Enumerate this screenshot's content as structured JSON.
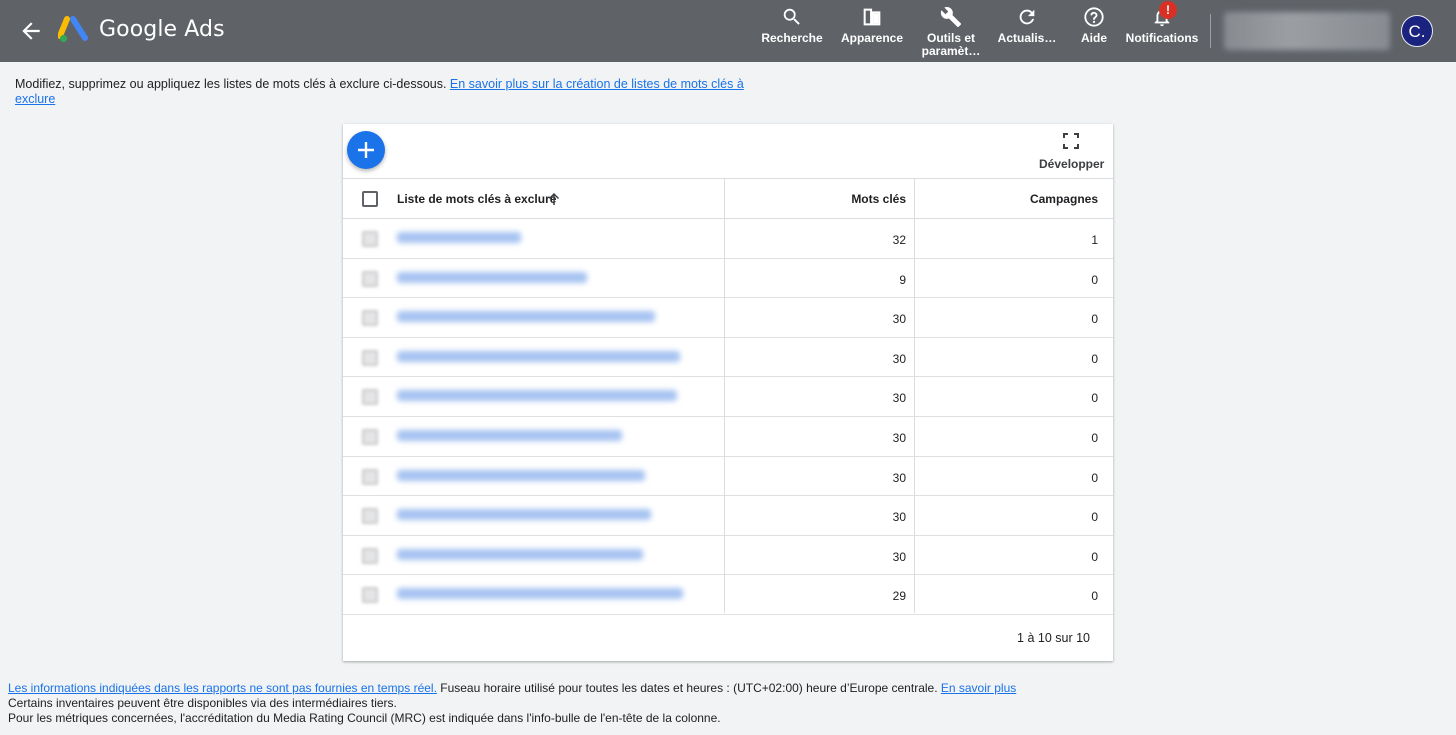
{
  "app": {
    "brand": "Google Ads",
    "avatar_letter": "C."
  },
  "toolbar": [
    {
      "label": "Recherche",
      "icon": "search-icon"
    },
    {
      "label": "Apparence",
      "icon": "appearance-icon"
    },
    {
      "label": "Outils et\nparamèt…",
      "icon": "wrench-icon"
    },
    {
      "label": "Actualis…",
      "icon": "refresh-icon"
    },
    {
      "label": "Aide",
      "icon": "help-icon"
    },
    {
      "label": "Notifications",
      "icon": "bell-icon",
      "badge": "!"
    }
  ],
  "intro": {
    "text": "Modifiez, supprimez ou appliquez les listes de mots clés à exclure ci-dessous. ",
    "link": "En savoir plus sur la création de listes de mots clés à exclure"
  },
  "card": {
    "expand_label": "Développer",
    "columns": {
      "name": "Liste de mots clés à exclure",
      "keywords": "Mots clés",
      "campaigns": "Campagnes"
    },
    "rows": [
      {
        "keywords": "32",
        "campaigns": "1"
      },
      {
        "keywords": "9",
        "campaigns": "0"
      },
      {
        "keywords": "30",
        "campaigns": "0"
      },
      {
        "keywords": "30",
        "campaigns": "0"
      },
      {
        "keywords": "30",
        "campaigns": "0"
      },
      {
        "keywords": "30",
        "campaigns": "0"
      },
      {
        "keywords": "30",
        "campaigns": "0"
      },
      {
        "keywords": "30",
        "campaigns": "0"
      },
      {
        "keywords": "30",
        "campaigns": "0"
      },
      {
        "keywords": "29",
        "campaigns": "0"
      }
    ],
    "pagination": "1 à 10 sur 10"
  },
  "footer": {
    "realtime_link": "Les informations indiquées dans les rapports ne sont pas fournies en temps réel.",
    "timezone_text": " Fuseau horaire utilisé pour toutes les dates et heures : (UTC+02:00) heure d’Europe centrale. ",
    "learn_more": "En savoir plus",
    "line2": "Certains inventaires peuvent être disponibles via des intermédiaires tiers.",
    "line3": "Pour les métriques concernées, l'accréditation du Media Rating Council (MRC) est indiquée dans l'info-bulle de l'en-tête de la colonne."
  },
  "colors": {
    "topbar": "#5f6368",
    "accent": "#1a73e8",
    "badge": "#d93025",
    "avatar": "#1a237e"
  }
}
